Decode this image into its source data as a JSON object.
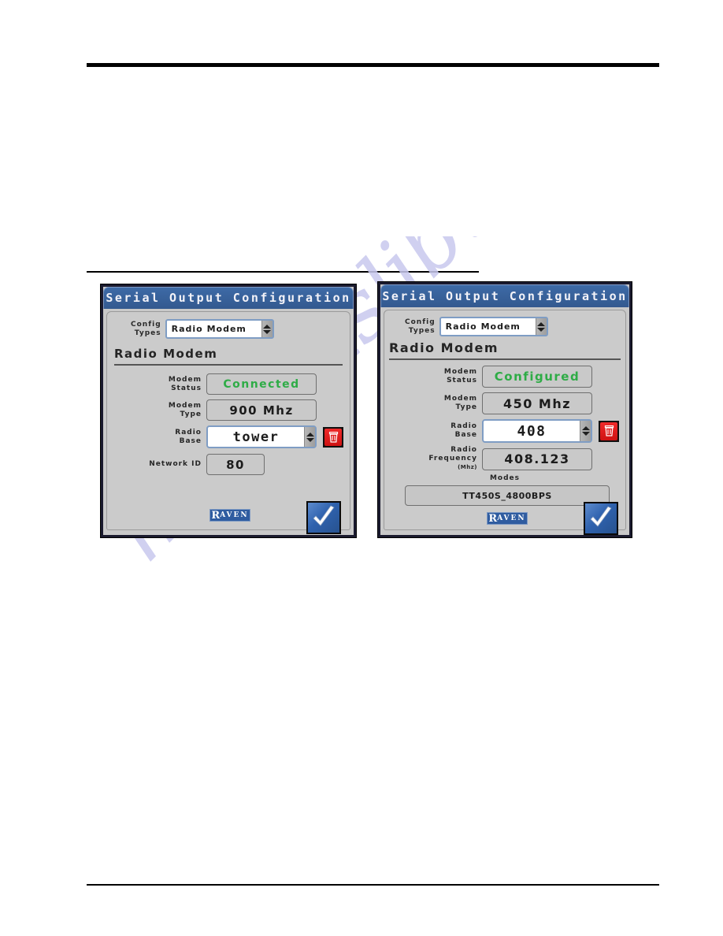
{
  "page": {
    "background_color": "#ffffff",
    "rules": {
      "top": "",
      "middle": "",
      "bottom": ""
    },
    "watermark": "manualslib.com",
    "watermark_color": "#c8c8ee"
  },
  "colors": {
    "titlebar_blue": "#36619b",
    "panel_gray": "#c9c9c9",
    "status_green": "#2eac46",
    "delete_red": "#e01b1b",
    "field_border_blue": "#7f9dc4",
    "accept_blue": "#2f62ae"
  },
  "screens": [
    {
      "id": "left",
      "titlebar": "Serial Output Configuration",
      "config_types": {
        "label_line1": "Config",
        "label_line2": "Types",
        "value": "Radio Modem"
      },
      "section_heading": "Radio Modem",
      "fields": [
        {
          "label_line1": "Modem",
          "label_line2": "Status",
          "sublabel": "",
          "value": "Connected",
          "style": "readonly-green",
          "has_spinner": false,
          "has_delete": false
        },
        {
          "label_line1": "Modem",
          "label_line2": "Type",
          "sublabel": "",
          "value": "900 Mhz",
          "style": "readonly",
          "has_spinner": false,
          "has_delete": false
        },
        {
          "label_line1": "Radio",
          "label_line2": "Base",
          "sublabel": "",
          "value": "tower",
          "style": "editable",
          "has_spinner": true,
          "has_delete": true
        },
        {
          "label_line1": "Network ID",
          "label_line2": "",
          "sublabel": "",
          "value": "80",
          "style": "readonly",
          "has_spinner": false,
          "has_delete": false
        }
      ],
      "modes": {
        "label": "",
        "value": ""
      },
      "logo": {
        "first": "R",
        "rest": "AVEN"
      },
      "accept_button": "✓"
    },
    {
      "id": "right",
      "titlebar": "Serial Output Configuration",
      "config_types": {
        "label_line1": "Config",
        "label_line2": "Types",
        "value": "Radio Modem"
      },
      "section_heading": "Radio Modem",
      "fields": [
        {
          "label_line1": "Modem",
          "label_line2": "Status",
          "sublabel": "",
          "value": "Configured",
          "style": "readonly-green",
          "has_spinner": false,
          "has_delete": false
        },
        {
          "label_line1": "Modem",
          "label_line2": "Type",
          "sublabel": "",
          "value": "450 Mhz",
          "style": "readonly",
          "has_spinner": false,
          "has_delete": false
        },
        {
          "label_line1": "Radio",
          "label_line2": "Base",
          "sublabel": "",
          "value": "408",
          "style": "editable",
          "has_spinner": true,
          "has_delete": true
        },
        {
          "label_line1": "Radio",
          "label_line2": "Frequency",
          "sublabel": "(Mhz)",
          "value": "408.123",
          "style": "readonly",
          "has_spinner": false,
          "has_delete": false
        }
      ],
      "modes": {
        "label": "Modes",
        "value": "TT450S_4800BPS"
      },
      "logo": {
        "first": "R",
        "rest": "AVEN"
      },
      "accept_button": "✓"
    }
  ]
}
